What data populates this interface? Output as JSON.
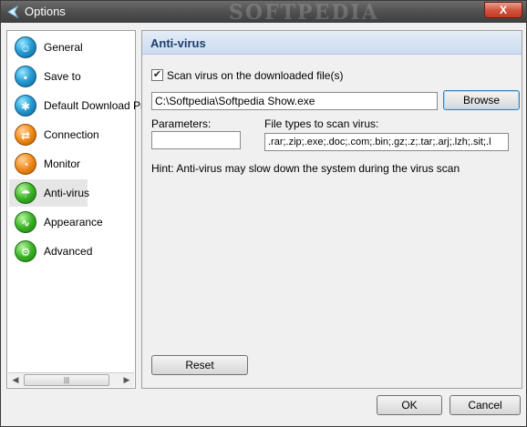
{
  "window": {
    "title": "Options",
    "watermark": "SOFTPEDIA",
    "close_glyph": "X"
  },
  "sidebar": {
    "items": [
      {
        "label": "General",
        "icon": "user-icon"
      },
      {
        "label": "Save to",
        "icon": "save-icon"
      },
      {
        "label": "Default Download Pr",
        "icon": "download-icon"
      },
      {
        "label": "Connection",
        "icon": "connection-icon"
      },
      {
        "label": "Monitor",
        "icon": "monitor-icon"
      },
      {
        "label": "Anti-virus",
        "icon": "umbrella-icon"
      },
      {
        "label": "Appearance",
        "icon": "appearance-icon"
      },
      {
        "label": "Advanced",
        "icon": "advanced-icon"
      }
    ],
    "selected": "Anti-virus"
  },
  "panel": {
    "title": "Anti-virus",
    "scan_checkbox_label": "Scan virus on the downloaded file(s)",
    "scan_checked": true,
    "scanner_path": "C:\\Softpedia\\Softpedia Show.exe",
    "browse_label": "Browse",
    "parameters_label": "Parameters:",
    "parameters_value": "",
    "file_types_label": "File types to scan virus:",
    "file_types_value": ".rar;.zip;.exe;.doc;.com;.bin;.gz;.z;.tar;.arj;.lzh;.sit;.l",
    "hint": "Hint: Anti-virus may slow down the system during the virus scan",
    "reset_label": "Reset"
  },
  "footer": {
    "ok_label": "OK",
    "cancel_label": "Cancel"
  },
  "colors": {
    "titlebar": "#505050",
    "close_button": "#c23a22",
    "panel_header": "#ccdcf0",
    "panel_header_text": "#1c3f6e"
  }
}
